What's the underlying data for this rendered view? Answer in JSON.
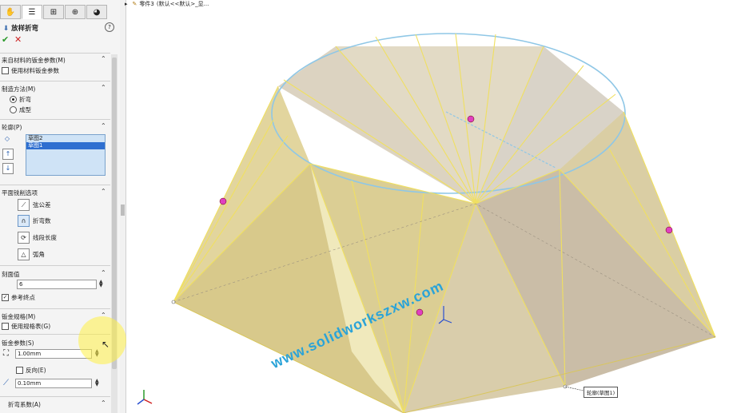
{
  "tabs": [
    {
      "icon": "feature-manager-icon",
      "glyph": "✋"
    },
    {
      "icon": "property-manager-icon",
      "glyph": "☰"
    },
    {
      "icon": "configuration-manager-icon",
      "glyph": "⊞"
    },
    {
      "icon": "dimxpert-icon",
      "glyph": "⊕"
    },
    {
      "icon": "display-manager-icon",
      "glyph": "◕"
    }
  ],
  "feature": {
    "title": "放样折弯",
    "help": "?"
  },
  "actions": {
    "ok": "✔",
    "cancel": "✕"
  },
  "sheet_params": {
    "header": "来自材料的钣金参数(M)",
    "use_material": "使用材料钣金参数",
    "use_material_checked": false
  },
  "method": {
    "header": "制造方法(M)",
    "options": [
      {
        "label": "折弯",
        "selected": true
      },
      {
        "label": "成型",
        "selected": false
      }
    ]
  },
  "profiles": {
    "header": "轮廓(P)",
    "items": [
      {
        "label": "草图2",
        "selected": false
      },
      {
        "label": "草图1",
        "selected": true
      }
    ]
  },
  "facet": {
    "header": "平面铣削选项",
    "options": [
      {
        "label": "弦公差",
        "icon": "chord-tolerance-icon",
        "glyph": "⟋"
      },
      {
        "label": "折弯数",
        "icon": "bend-count-icon",
        "glyph": "∩"
      },
      {
        "label": "线段长度",
        "icon": "segment-length-icon",
        "glyph": "⟳"
      },
      {
        "label": "弧角",
        "icon": "arc-angle-icon",
        "glyph": "△"
      }
    ]
  },
  "facet_value": {
    "header": "刻面值",
    "value": "6",
    "ref_endpoint": "参考终点",
    "ref_checked": true
  },
  "gauge": {
    "header": "钣金规格(M)",
    "use_table": "使用规格表(G)",
    "use_table_checked": false
  },
  "sheet_metal": {
    "header": "钣金参数(S)",
    "thickness": "1.00mm",
    "reverse": "反向(E)",
    "reverse_checked": false,
    "radius": "0.10mm"
  },
  "bend_allowance": {
    "header": "折弯系数(A)"
  },
  "breadcrumb": {
    "part": "零件3",
    "config": "(默认<<默认>_显..."
  },
  "watermark": "www.solidworkszxw.com",
  "callout": "轮廓(草图1)",
  "colors": {
    "face": "#d9c886",
    "edge": "#f0e060",
    "circle_edge": "#8fc7e6",
    "point": "#e040c0"
  }
}
